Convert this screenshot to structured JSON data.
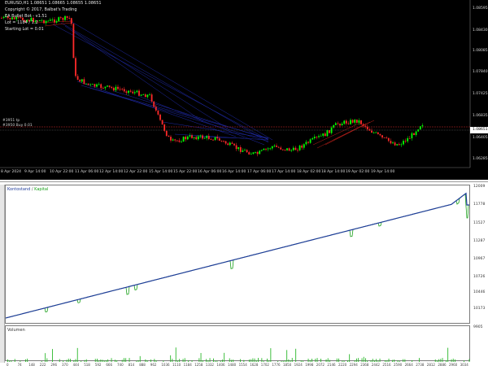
{
  "top_chart": {
    "symbol_header": "EURUSD,H1  1.08651 1.08665 1.08655 1.08651",
    "copyright": "Copyright © 2017, Balbat's Trading",
    "ea_name": "EA Bullet Bot - v1.51",
    "lot_line": "Lot = 1184 / 1.2",
    "starting_lot": "Starting Lot = 0.01",
    "level_label_1": "#3951 tp",
    "level_label_2": "#3950 Buy 0.01",
    "current_price": "1.08651",
    "price_labels": [
      "1.08595",
      "1.08430",
      "1.08085",
      "1.07840",
      "1.07425",
      "1.06835",
      "1.06405",
      "1.06285"
    ],
    "date_labels": [
      "8 Apr 2024",
      "9 Apr 14:00",
      "10 Apr 22:00",
      "11 Apr 06:00",
      "12 Apr 14:00",
      "12 Apr 22:00",
      "15 Apr 14:00",
      "15 Apr 22:00",
      "16 Apr 06:00",
      "16 Apr 14:00",
      "17 Apr 06:00",
      "17 Apr 14:00",
      "18 Apr 02:00",
      "18 Apr 14:00",
      "19 Apr 02:00",
      "19 Apr 14:00"
    ],
    "colors": {
      "bull": "#00ff00",
      "bear": "#ff2a2a",
      "trade_line_blue": "#1f2aa8",
      "trade_line_red": "#c0201a",
      "level_line": "#8a1a1a"
    }
  },
  "tester": {
    "legend_balance": "Kontostand",
    "legend_sep": " / ",
    "legend_equity": "Kapital",
    "volume_title": "Volumen",
    "y_labels": [
      "12009",
      "11778",
      "11527",
      "11287",
      "10967",
      "10726",
      "10446",
      "10173"
    ],
    "volume_y_label": "9905",
    "x_labels": [
      "0",
      "74",
      "148",
      "222",
      "296",
      "370",
      "444",
      "518",
      "592",
      "666",
      "740",
      "814",
      "888",
      "962",
      "1036",
      "1110",
      "1184",
      "1258",
      "1332",
      "1406",
      "1480",
      "1554",
      "1628",
      "1702",
      "1776",
      "1850",
      "1924",
      "1998",
      "2072",
      "2146",
      "2220",
      "2294",
      "2368",
      "2442",
      "2516",
      "2590",
      "2664",
      "2738",
      "2812",
      "2886",
      "2960",
      "3034"
    ],
    "colors": {
      "balance": "#1f3c9a",
      "equity": "#1aa01a",
      "volume": "#2cb82c"
    }
  }
}
